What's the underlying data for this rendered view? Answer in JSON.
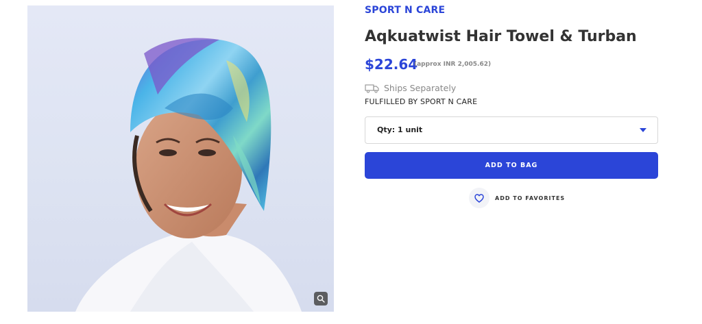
{
  "product": {
    "brand": "SPORT N CARE",
    "title": "Aqkuatwist Hair Towel & Turban",
    "price": "$22.64",
    "price_approx": "(approx INR 2,005.62)",
    "shipping": {
      "icon": "truck-icon",
      "text": "Ships Separately"
    },
    "fulfilled_by": "FULFILLED BY SPORT N CARE",
    "image_alt": "Woman wearing colorful Aqkuatwist hair towel turban",
    "zoom_icon": "magnifier-icon"
  },
  "actions": {
    "quantity_selected": "Qty: 1 unit",
    "add_to_bag": "ADD TO BAG",
    "add_to_favorites": "ADD TO FAVORITES",
    "favorites_icon": "heart-icon"
  },
  "colors": {
    "accent": "#2b45d8",
    "title": "#333333",
    "muted": "#888888"
  }
}
